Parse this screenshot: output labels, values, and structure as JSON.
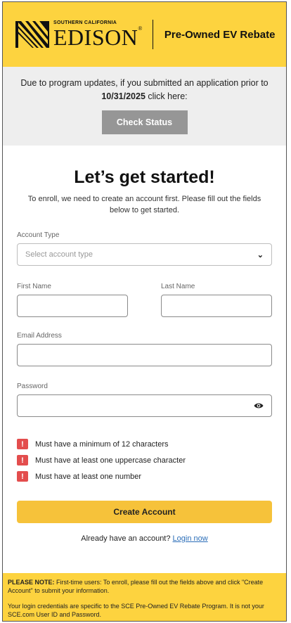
{
  "header": {
    "brand_small": "SOUTHERN CALIFORNIA",
    "brand_big": "EDISON",
    "brand_mark": "®",
    "title": "Pre-Owned EV Rebate"
  },
  "notice": {
    "text_before": "Due to program updates, if you submitted an application prior to ",
    "date": "10/31/2025",
    "text_after": " click here:",
    "button": "Check Status"
  },
  "form": {
    "heading": "Let’s get started!",
    "intro": "To enroll, we need to create an account first. Please fill out the fields below to get started.",
    "account_type_label": "Account Type",
    "account_type_placeholder": "Select account type",
    "first_name_label": "First Name",
    "first_name_value": "",
    "last_name_label": "Last Name",
    "last_name_value": "",
    "email_label": "Email Address",
    "email_value": "",
    "password_label": "Password",
    "password_value": ""
  },
  "rules": [
    {
      "badge": "!",
      "text": "Must have a minimum of 12 characters"
    },
    {
      "badge": "!",
      "text": "Must have at least one uppercase character"
    },
    {
      "badge": "!",
      "text": "Must have at least one number"
    }
  ],
  "actions": {
    "create_button": "Create Account",
    "login_prompt": "Already have an account? ",
    "login_link": "Login now"
  },
  "footer": {
    "note_label": "PLEASE NOTE:",
    "note_text": " First-time users: To enroll, please fill out the fields above and click \"Create Account\" to submit your information.",
    "credentials_text": "Your login credentials are specific to the SCE Pre-Owned EV Rebate Program. It is not your SCE.com User ID and Password."
  },
  "colors": {
    "brand_yellow": "#fdd33f",
    "button_yellow": "#f6c23a",
    "error_red": "#e34d4d",
    "link_blue": "#2a6db8"
  }
}
